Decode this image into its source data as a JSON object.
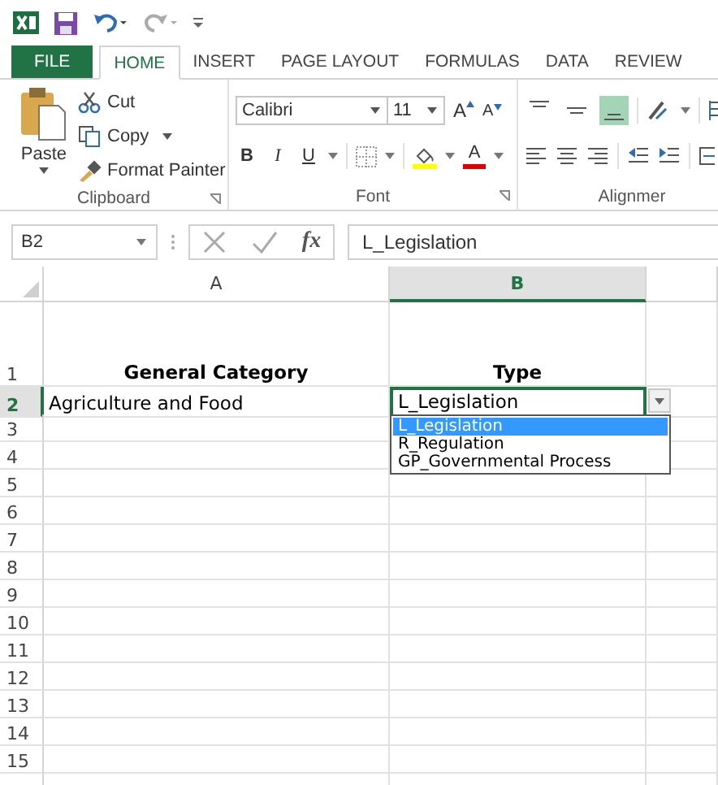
{
  "tabs": [
    {
      "label": "FILE",
      "kind": "file",
      "selected": false
    },
    {
      "label": "HOME",
      "kind": "tab",
      "selected": true
    },
    {
      "label": "INSERT",
      "kind": "tab",
      "selected": false
    },
    {
      "label": "PAGE LAYOUT",
      "kind": "tab",
      "selected": false
    },
    {
      "label": "FORMULAS",
      "kind": "tab",
      "selected": false
    },
    {
      "label": "DATA",
      "kind": "tab",
      "selected": false
    },
    {
      "label": "REVIEW",
      "kind": "tab",
      "selected": false
    }
  ],
  "clipboard": {
    "label": "Clipboard",
    "paste": "Paste",
    "cut": "Cut",
    "copy": "Copy",
    "format_painter": "Format Painter"
  },
  "font": {
    "label": "Font",
    "font_name": "Calibri",
    "font_size": "11",
    "grow": "A",
    "shrink": "A",
    "bold": "B",
    "italic": "I",
    "underline": "U",
    "font_color": "A"
  },
  "alignment": {
    "label": "Alignmer",
    "vertical": [
      {
        "kind": "top",
        "selected": false
      },
      {
        "kind": "middle",
        "selected": false
      },
      {
        "kind": "bottom",
        "selected": true
      }
    ]
  },
  "formula_bar": {
    "name_box": "B2",
    "fx": "fx",
    "formula": "L_Legislation"
  },
  "columns": [
    {
      "label": "A",
      "selected": false
    },
    {
      "label": "B",
      "selected": true
    }
  ],
  "rows": [
    {
      "label": "1",
      "kind": "header",
      "selected": false,
      "cells": [
        {
          "text": "General Category",
          "active": false
        },
        {
          "text": "Type",
          "active": false
        }
      ]
    },
    {
      "label": "2",
      "kind": "data",
      "selected": true,
      "cells": [
        {
          "text": "Agriculture and Food",
          "active": false
        },
        {
          "text": "L_Legislation",
          "active": true
        }
      ]
    },
    {
      "label": "3",
      "kind": "data",
      "selected": false,
      "cells": []
    },
    {
      "label": "4",
      "kind": "data",
      "selected": false,
      "cells": []
    },
    {
      "label": "5",
      "kind": "data",
      "selected": false,
      "cells": []
    },
    {
      "label": "6",
      "kind": "data",
      "selected": false,
      "cells": []
    },
    {
      "label": "7",
      "kind": "data",
      "selected": false,
      "cells": []
    },
    {
      "label": "8",
      "kind": "data",
      "selected": false,
      "cells": []
    },
    {
      "label": "9",
      "kind": "data",
      "selected": false,
      "cells": []
    },
    {
      "label": "10",
      "kind": "data",
      "selected": false,
      "cells": []
    },
    {
      "label": "11",
      "kind": "data",
      "selected": false,
      "cells": []
    },
    {
      "label": "12",
      "kind": "data",
      "selected": false,
      "cells": []
    },
    {
      "label": "13",
      "kind": "data",
      "selected": false,
      "cells": []
    },
    {
      "label": "14",
      "kind": "data",
      "selected": false,
      "cells": []
    },
    {
      "label": "15",
      "kind": "data",
      "selected": false,
      "cells": []
    }
  ],
  "dropdown": {
    "items": [
      {
        "label": "L_Legislation",
        "selected": true
      },
      {
        "label": "R_Regulation",
        "selected": false
      },
      {
        "label": "GP_Governmental Process",
        "selected": false
      }
    ]
  }
}
